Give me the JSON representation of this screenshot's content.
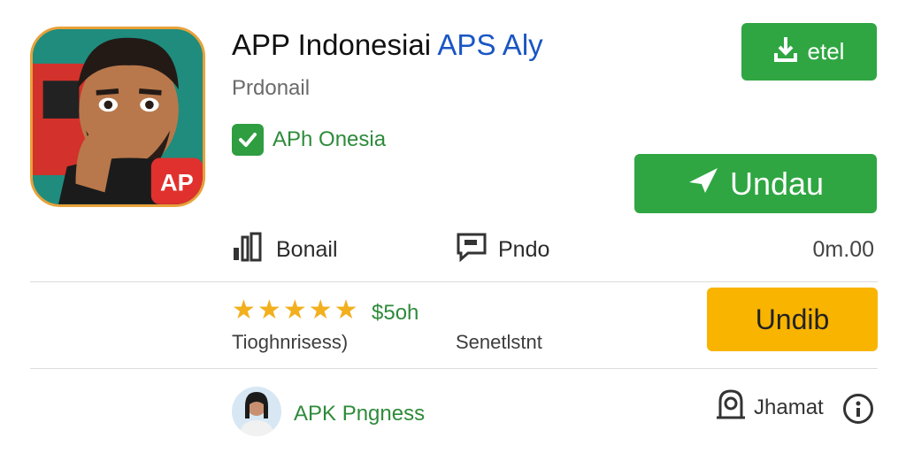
{
  "app": {
    "title_main": "APP Indonesiai",
    "title_accent": "APS Aly",
    "subtitle": "Prdonail",
    "verified_label": "APh Onesia",
    "icon_badge": "AP"
  },
  "buttons": {
    "install_label": "etel",
    "download_label": "Undau",
    "secondary_label": "Undib"
  },
  "meta": {
    "left_label": "Bonail",
    "middle_label": "Pndo",
    "size": "0m.00"
  },
  "rating": {
    "stars": 5,
    "price": "$5oh",
    "label_left": "Tioghnrisess)",
    "label_right": "Senetlstnt"
  },
  "developer": {
    "name": "APK Pngness",
    "action_label": "Jhamat"
  },
  "colors": {
    "primary_green": "#2fa642",
    "secondary_yellow": "#f9b400",
    "accent_blue": "#1a56c4",
    "star": "#f2b01e"
  },
  "icons": {
    "install": "download-icon",
    "download": "send-icon",
    "verified": "check-icon",
    "meta_left": "chart-icon",
    "meta_middle": "chat-icon",
    "developer_action": "person-icon",
    "info": "info-icon"
  }
}
